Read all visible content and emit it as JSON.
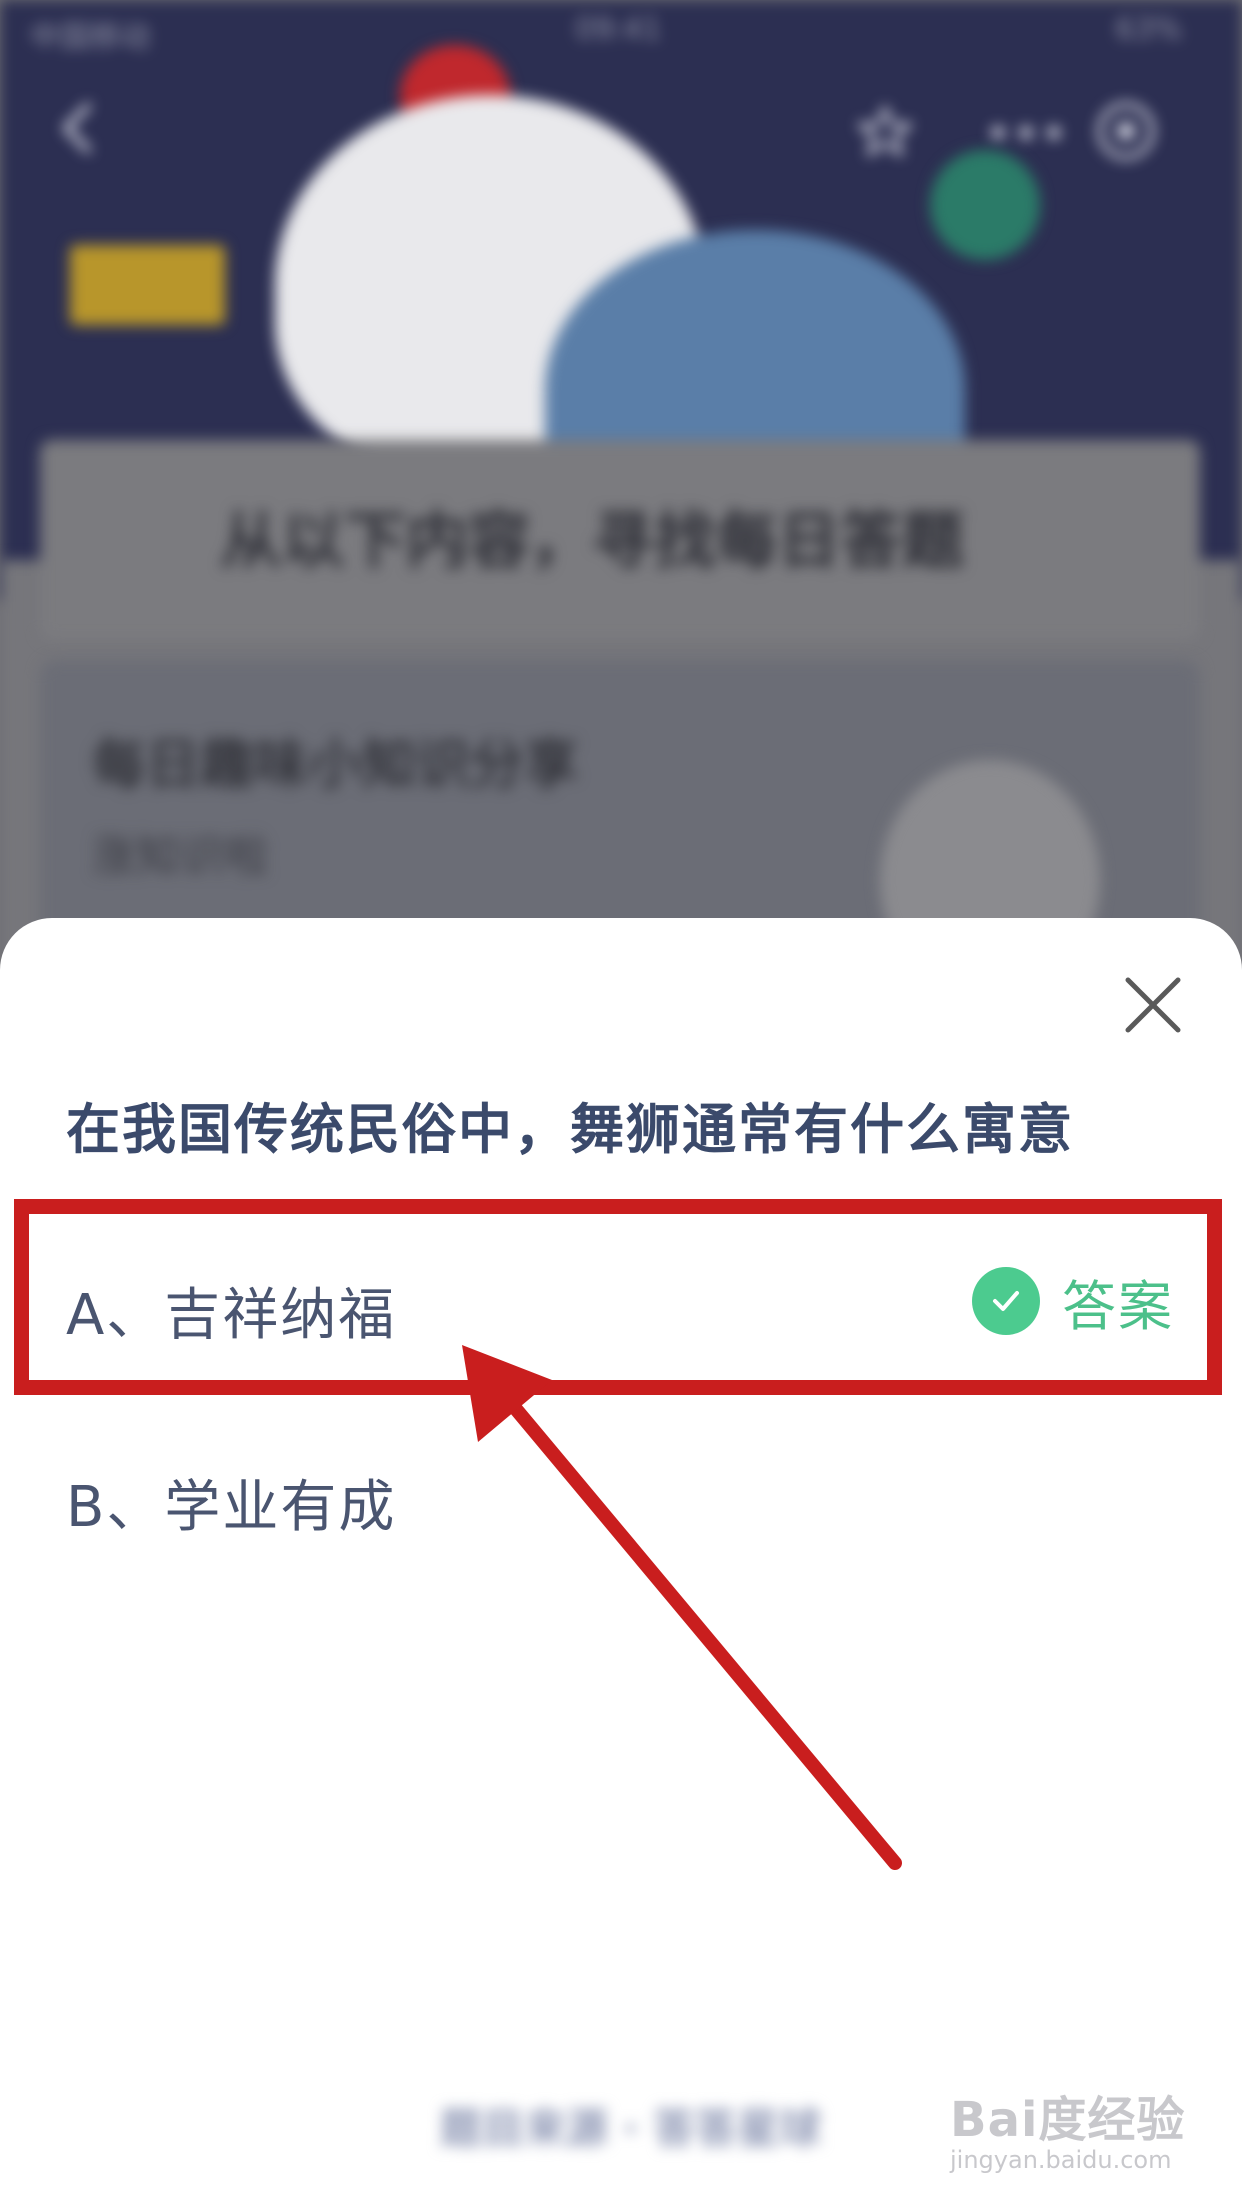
{
  "status_bar": {
    "carrier": "中国移动",
    "time": "09:41",
    "battery": "63%"
  },
  "background": {
    "hero_title": "从以下内容，寻找每日答题",
    "card_title": "每日趣味小知识分享",
    "card_subtitle": "涨知识啦",
    "footer": "题目来源 · 答答星球"
  },
  "quiz": {
    "question": "在我国传统民俗中，舞狮通常有什么寓意",
    "options": [
      {
        "label": "A、吉祥纳福"
      },
      {
        "label": "B、学业有成"
      }
    ],
    "answer_label": "答案",
    "correct_option": "A"
  },
  "watermark": {
    "logo": "Bai度经验",
    "url": "jingyan.baidu.com"
  },
  "colors": {
    "question": "#3b4a6b",
    "option_text": "#4a5570",
    "answer_green": "#4ccb8f",
    "highlight_red": "#c91e1e"
  }
}
